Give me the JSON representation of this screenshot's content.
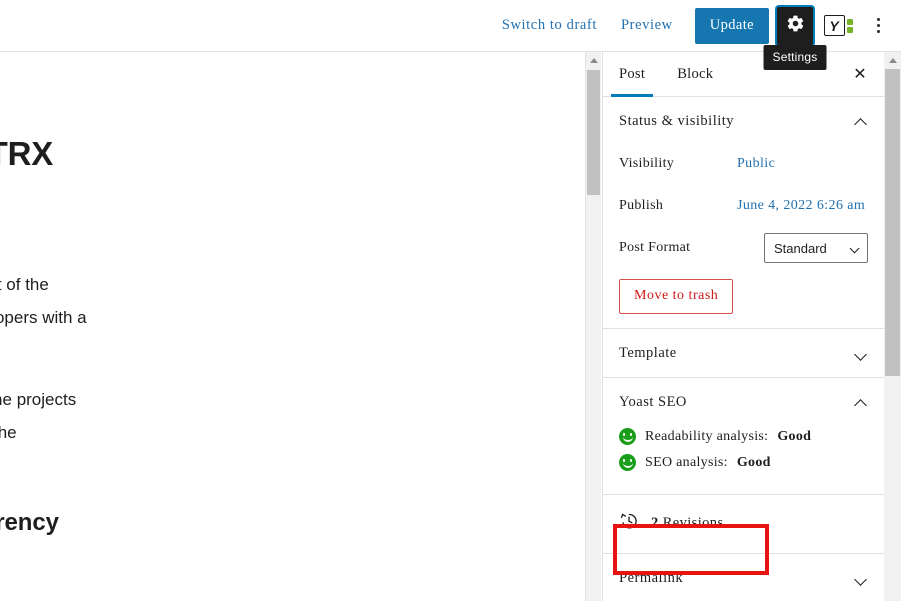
{
  "header": {
    "switch_to_draft": "Switch to draft",
    "preview": "Preview",
    "update": "Update",
    "settings_tooltip": "Settings",
    "yoast_letter": "Y",
    "accent_blue": "#1677b0",
    "focus_blue": "#007cba"
  },
  "editor": {
    "heading": "bout TRX",
    "paragraph1_line1": "at the height of the",
    "paragraph1_line2": "s and developers with a",
    "paragraph2_line1": "on among the projects",
    "paragraph2_line2": "criticism of the",
    "subheading": "yptocurrency"
  },
  "sidebar": {
    "tabs": [
      {
        "label": "Post",
        "active": true
      },
      {
        "label": "Block",
        "active": false
      }
    ],
    "close_label": "✕",
    "status": {
      "title": "Status & visibility",
      "visibility_label": "Visibility",
      "visibility_value": "Public",
      "publish_label": "Publish",
      "publish_value": "June 4, 2022 6:26 am",
      "post_format_label": "Post Format",
      "post_format_value": "Standard",
      "trash_label": "Move to trash"
    },
    "template": {
      "title": "Template"
    },
    "yoast": {
      "title": "Yoast SEO",
      "readability_label": "Readability analysis:",
      "readability_value": "Good",
      "seo_label": "SEO analysis:",
      "seo_value": "Good",
      "good_color": "#1a9e1a"
    },
    "revisions": {
      "count": "2",
      "label": "Revisions",
      "highlight_color": "#e8140f"
    },
    "permalink": {
      "title": "Permalink"
    }
  }
}
